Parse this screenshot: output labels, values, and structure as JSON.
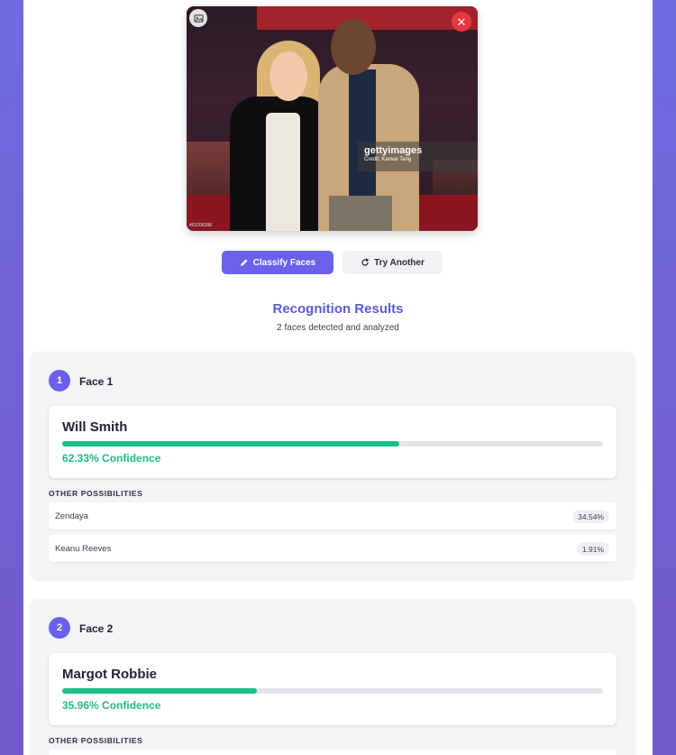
{
  "photo": {
    "watermark_logo": "gettyimages",
    "watermark_credit": "Credit: Karwai Tang",
    "image_id": "463208388",
    "photo_icon": "image-icon",
    "close_icon": "close-icon"
  },
  "actions": {
    "classify_label": "Classify Faces",
    "classify_icon": "pencil-icon",
    "try_another_label": "Try Another",
    "try_another_icon": "refresh-icon"
  },
  "results": {
    "title": "Recognition Results",
    "subtitle": "2 faces detected and analyzed"
  },
  "faces": [
    {
      "number": "1",
      "label": "Face 1",
      "top_match": {
        "name": "Will Smith",
        "confidence": 62.33,
        "confidence_text": "62.33% Confidence"
      },
      "other_title": "OTHER POSSIBILITIES",
      "alternatives": [
        {
          "name": "Zendaya",
          "percent": "34.54%"
        },
        {
          "name": "Keanu Reeves",
          "percent": "1.91%"
        }
      ]
    },
    {
      "number": "2",
      "label": "Face 2",
      "top_match": {
        "name": "Margot Robbie",
        "confidence": 35.96,
        "confidence_text": "35.96% Confidence"
      },
      "other_title": "OTHER POSSIBILITIES",
      "alternatives": []
    }
  ],
  "colors": {
    "accent": "#6a60ec",
    "success": "#1ebc86",
    "danger": "#e8383d"
  }
}
